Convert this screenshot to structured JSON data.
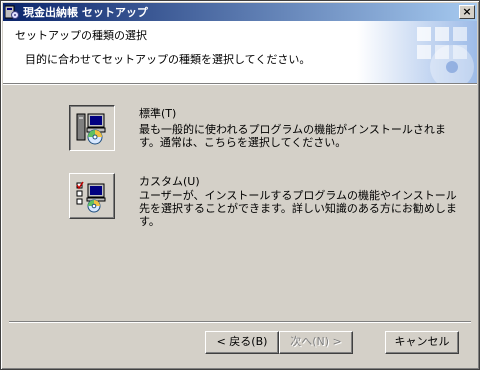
{
  "window": {
    "title": "現金出納帳 セットアップ",
    "close_label": "×"
  },
  "banner": {
    "title": "セットアップの種類の選択",
    "subtitle": "目的に合わせてセットアップの種類を選択してください。"
  },
  "options": [
    {
      "title": "標準(T)",
      "description": "最も一般的に使われるプログラムの機能がインストールされます。通常は、こちらを選択してください。",
      "selected": true,
      "icon": "setup-standard-icon"
    },
    {
      "title": "カスタム(U)",
      "description": "ユーザーが、インストールするプログラムの機能やインストール先を選択することができます。詳しい知識のある方にお勧めします。",
      "selected": false,
      "icon": "setup-custom-icon"
    }
  ],
  "buttons": {
    "back": "< 戻る(B)",
    "next": "次へ(N) >",
    "cancel": "キャンセル"
  },
  "colors": {
    "titlebar_start": "#0a246a",
    "titlebar_end": "#a6caf0",
    "face": "#d4d0c8"
  }
}
